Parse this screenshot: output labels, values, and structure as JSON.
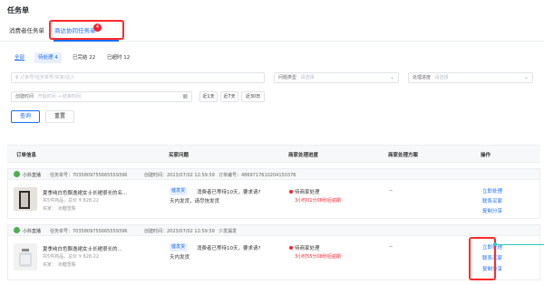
{
  "page": {
    "title": "任务单"
  },
  "tabs": [
    {
      "label": "消费者任务单"
    },
    {
      "label": "商达协同任务单",
      "badge": "4"
    }
  ],
  "filter_tabs": [
    {
      "label": "全部"
    },
    {
      "label": "待处理 4"
    },
    {
      "label": "已完结 22"
    },
    {
      "label": "已超时 12"
    }
  ],
  "search": {
    "placeholder": "订单号/任务单号/买家/达人"
  },
  "problem_type": {
    "label": "问题类型",
    "placeholder": "请选择"
  },
  "progress": {
    "label": "处理进度",
    "placeholder": "请选择"
  },
  "created_time": {
    "label": "创建时间",
    "start": "开始时间",
    "sep": "→",
    "end": "结束时间"
  },
  "quick_dates": [
    "近1天",
    "近7天",
    "近30日"
  ],
  "buttons": {
    "query": "查询",
    "reset": "重置"
  },
  "table": {
    "headers": [
      "订单信息",
      "买家问题",
      "商家处理进度",
      "商家处理方案",
      "操作"
    ]
  },
  "orders": [
    {
      "shop": "小抖直播",
      "task_id": "任务单号：7035809755665559396",
      "created": "创建时间：2023/07/02 12:59:59",
      "order_id": "订单编号：4869717610204150376",
      "product_title": "夏季纯白色飘逸裙女士长裙很长的名...",
      "product_meta": "共5件商品，总价 ¥ 828.22",
      "buyer": "买家：  冰糖雪梨",
      "tag": "催发货",
      "problem": "消费者已等待10天，要求请?",
      "problem_sub": "天内发货，请尽快发货",
      "status": "待商家处理",
      "countdown": "3小时01分08秒后逾期",
      "plan": "--",
      "actions": [
        "立即处理",
        "联系买家",
        "复制分享"
      ]
    },
    {
      "shop": "小抖直播",
      "task_id": "任务单号：7035809755665559396",
      "created": "创建时间：2023/07/02 12:59:59",
      "order_id": "少发漏发",
      "product_title": "夏季纯白色飘逸裙女士长裙很长的...",
      "product_meta": "共5件商品，总价 ¥ 828.22",
      "buyer": "买家：  冰糖雪梨",
      "tag": "催发货",
      "problem": "消费者已等待10天，要求请?",
      "problem_sub": "天内发货",
      "status": "待商家处理",
      "countdown": "3小时55分08秒后逾期",
      "plan": "--",
      "actions": [
        "立即处理",
        "联系买家",
        "复制分享"
      ]
    }
  ]
}
